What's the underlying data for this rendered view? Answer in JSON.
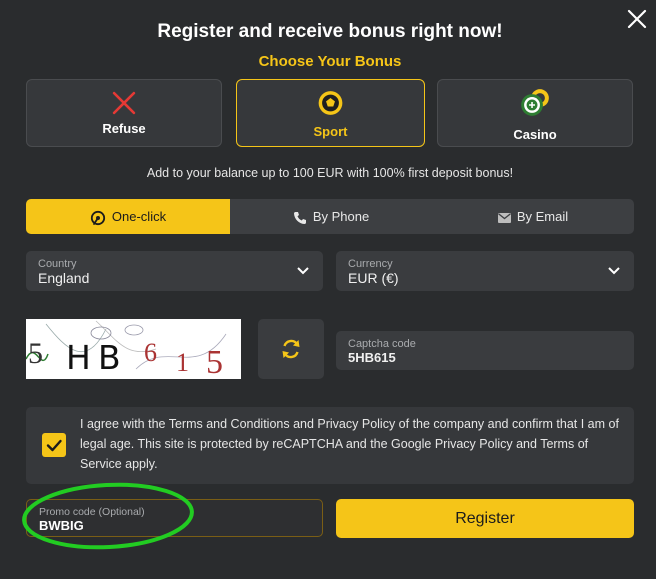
{
  "dialog": {
    "title": "Register and receive bonus right now!",
    "subtitle": "Choose Your Bonus",
    "description": "Add to your balance up to 100 EUR with 100% first deposit bonus!"
  },
  "bonus_options": [
    {
      "label": "Refuse",
      "icon": "x-icon",
      "selected": false
    },
    {
      "label": "Sport",
      "icon": "soccer-ball-icon",
      "selected": true
    },
    {
      "label": "Casino",
      "icon": "casino-chips-icon",
      "selected": false
    }
  ],
  "tabs": [
    {
      "label": "One-click",
      "icon": "one-click-icon",
      "active": true
    },
    {
      "label": "By Phone",
      "icon": "phone-icon",
      "active": false
    },
    {
      "label": "By Email",
      "icon": "email-icon",
      "active": false
    }
  ],
  "country": {
    "label": "Country",
    "value": "England"
  },
  "currency": {
    "label": "Currency",
    "value": "EUR (€)"
  },
  "captcha": {
    "image_text": "5HB615",
    "label": "Captcha code",
    "value": "5HB615"
  },
  "agreement": {
    "checked": true,
    "text": "I agree with the Terms and Conditions and Privacy Policy of the company and confirm that I am of legal age. This site is protected by reCAPTCHA and the Google Privacy Policy and Terms of Service apply."
  },
  "promo": {
    "label": "Promo code (Optional)",
    "value": "BWBIG"
  },
  "register_label": "Register",
  "colors": {
    "accent": "#f5c518",
    "background": "#2a2c2e",
    "annotation": "#22cc22"
  }
}
